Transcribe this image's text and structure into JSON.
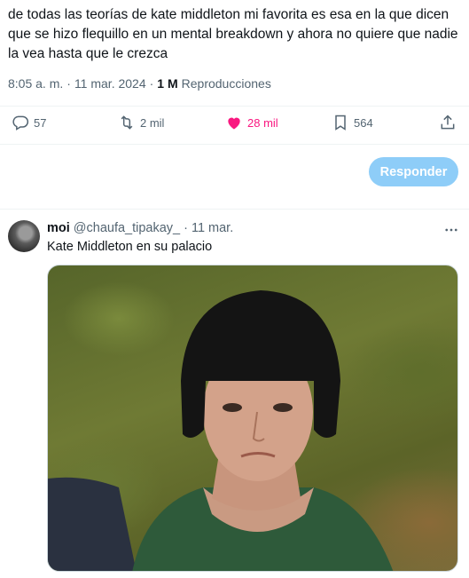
{
  "tweet": {
    "text": "de todas las teorías de kate middleton mi favorita es esa en la que dicen que se hizo flequillo en un mental breakdown y ahora no quiere que nadie la vea hasta que le crezca",
    "time": "8:05 a. m.",
    "separator": "·",
    "date": "11 mar. 2024",
    "views_count": "1 M",
    "views_label": "Reproducciones"
  },
  "actions": {
    "replies": "57",
    "retweets": "2 mil",
    "likes": "28 mil",
    "bookmarks": "564",
    "liked": true
  },
  "reply_button": {
    "label": "Responder"
  },
  "reply": {
    "name": "moi",
    "handle": "@chaufa_tipakay_",
    "separator": "·",
    "date": "11 mar.",
    "text": "Kate Middleton en su palacio"
  },
  "colors": {
    "text_primary": "#0f1419",
    "text_secondary": "#536471",
    "like_pink": "#f91880",
    "reply_button_blue": "#8ecdf8",
    "divider": "#eff3f4"
  },
  "icons": [
    "reply-icon",
    "retweet-icon",
    "heart-icon",
    "bookmark-icon",
    "share-icon",
    "more-icon"
  ]
}
